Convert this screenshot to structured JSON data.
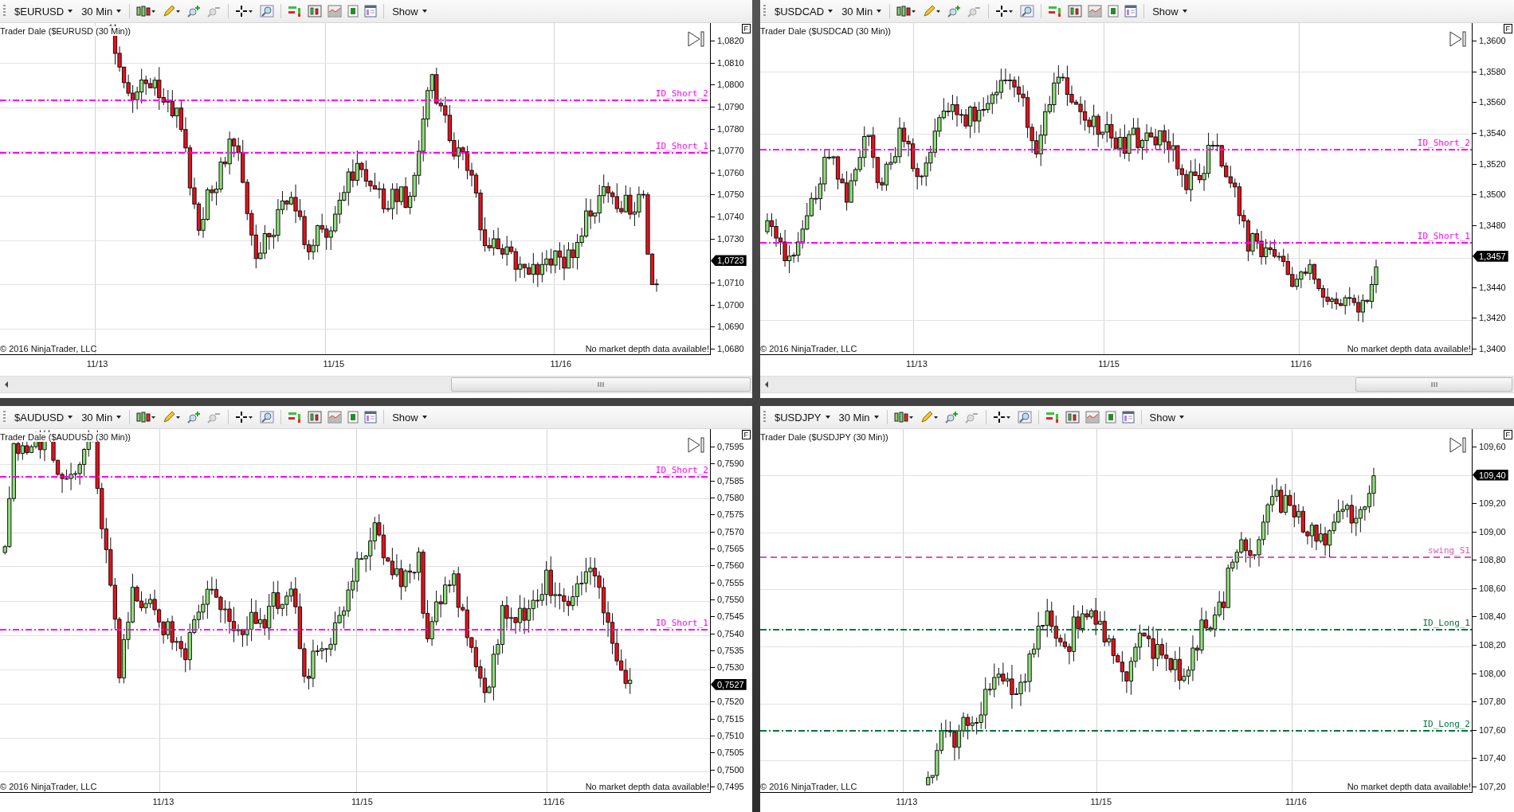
{
  "panels": [
    {
      "symbol": "$EURUSD",
      "interval": "30 Min",
      "show_menu": "Show",
      "title": "Trader Dale  ($EURUSD (30 Min))",
      "copyright": "© 2016 NinjaTrader, LLC",
      "notice": "No market depth data available!",
      "f_button": "F",
      "scroll_bar": true,
      "price_axis": [
        {
          "kind": "tick",
          "label": "1,0820"
        },
        {
          "kind": "tick",
          "label": "1,0810"
        },
        {
          "kind": "tick",
          "label": "1,0800"
        },
        {
          "kind": "tick",
          "label": "1,0790"
        },
        {
          "kind": "tick",
          "label": "1,0780"
        },
        {
          "kind": "tick",
          "label": "1,0770"
        },
        {
          "kind": "tick",
          "label": "1,0760"
        },
        {
          "kind": "tick",
          "label": "1,0750"
        },
        {
          "kind": "tick",
          "label": "1,0740"
        },
        {
          "kind": "tick",
          "label": "1,0730"
        },
        {
          "kind": "current",
          "label": "1,0723"
        },
        {
          "kind": "tick",
          "label": "1,0710"
        },
        {
          "kind": "tick",
          "label": "1,0700"
        },
        {
          "kind": "tick",
          "label": "1,0690"
        },
        {
          "kind": "tick",
          "label": "1,0680"
        }
      ],
      "levels": [
        {
          "label": "ID_Short_2",
          "kind": "dash_dot",
          "color": "#ff00ff"
        },
        {
          "label": "ID_Short_1",
          "kind": "dash_dot",
          "color": "#ff00ff"
        }
      ],
      "dates": [
        "11/13",
        "11/15",
        "11/16"
      ]
    },
    {
      "symbol": "$USDCAD",
      "interval": "30 Min",
      "show_menu": "Show",
      "title": "Trader Dale  ($USDCAD (30 Min))",
      "copyright": "© 2016 NinjaTrader, LLC",
      "notice": "No market depth data available!",
      "f_button": "F",
      "scroll_bar": true,
      "price_axis": [
        {
          "kind": "tick",
          "label": "1,3600"
        },
        {
          "kind": "tick",
          "label": "1,3580"
        },
        {
          "kind": "tick",
          "label": "1,3560"
        },
        {
          "kind": "tick",
          "label": "1,3540"
        },
        {
          "kind": "tick",
          "label": "1,3520"
        },
        {
          "kind": "tick",
          "label": "1,3500"
        },
        {
          "kind": "tick",
          "label": "1,3480"
        },
        {
          "kind": "current",
          "label": "1,3457"
        },
        {
          "kind": "tick",
          "label": "1,3440"
        },
        {
          "kind": "tick",
          "label": "1,3420"
        },
        {
          "kind": "tick",
          "label": "1,3400"
        }
      ],
      "levels": [
        {
          "label": "ID_Short_2",
          "kind": "dash_dot",
          "color": "#ff00ff"
        },
        {
          "label": "ID_Short_1",
          "kind": "dash_dot",
          "color": "#ff00ff"
        }
      ],
      "dates": [
        "11/13",
        "11/15",
        "11/16"
      ]
    },
    {
      "symbol": "$AUDUSD",
      "interval": "30 Min",
      "show_menu": "Show",
      "title": "Trader Dale  ($AUDUSD (30 Min))",
      "copyright": "© 2016 NinjaTrader, LLC",
      "notice": "No market depth data available!",
      "f_button": "F",
      "scroll_bar": false,
      "price_axis": [
        {
          "kind": "tick",
          "label": "0,7595"
        },
        {
          "kind": "tick",
          "label": "0,7590"
        },
        {
          "kind": "tick",
          "label": "0,7585"
        },
        {
          "kind": "tick",
          "label": "0,7580"
        },
        {
          "kind": "tick",
          "label": "0,7575"
        },
        {
          "kind": "tick",
          "label": "0,7570"
        },
        {
          "kind": "tick",
          "label": "0,7565"
        },
        {
          "kind": "tick",
          "label": "0,7560"
        },
        {
          "kind": "tick",
          "label": "0,7555"
        },
        {
          "kind": "tick",
          "label": "0,7550"
        },
        {
          "kind": "tick",
          "label": "0,7545"
        },
        {
          "kind": "tick",
          "label": "0,7540"
        },
        {
          "kind": "tick",
          "label": "0,7535"
        },
        {
          "kind": "tick",
          "label": "0,7530"
        },
        {
          "kind": "current",
          "label": "0,7527"
        },
        {
          "kind": "tick",
          "label": "0,7520"
        },
        {
          "kind": "tick",
          "label": "0,7515"
        },
        {
          "kind": "tick",
          "label": "0,7510"
        },
        {
          "kind": "tick",
          "label": "0,7505"
        },
        {
          "kind": "tick",
          "label": "0,7500"
        },
        {
          "kind": "tick",
          "label": "0,7495"
        }
      ],
      "levels": [
        {
          "label": "ID_Short_2",
          "kind": "dash_dot",
          "color": "#ff00ff"
        },
        {
          "label": "ID_Short_1",
          "kind": "dash_dot",
          "color": "#ff00ff"
        }
      ],
      "dates": [
        "11/13",
        "11/15",
        "11/16"
      ]
    },
    {
      "symbol": "$USDJPY",
      "interval": "30 Min",
      "show_menu": "Show",
      "title": "Trader Dale  ($USDJPY (30 Min))",
      "copyright": "© 2016 NinjaTrader, LLC",
      "notice": "No market depth data available!",
      "f_button": "F",
      "scroll_bar": false,
      "price_axis": [
        {
          "kind": "tick",
          "label": "109,60"
        },
        {
          "kind": "current",
          "label": "109,40"
        },
        {
          "kind": "tick",
          "label": "109,20"
        },
        {
          "kind": "tick",
          "label": "109,00"
        },
        {
          "kind": "tick",
          "label": "108,80"
        },
        {
          "kind": "tick",
          "label": "108,60"
        },
        {
          "kind": "tick",
          "label": "108,40"
        },
        {
          "kind": "tick",
          "label": "108,20"
        },
        {
          "kind": "tick",
          "label": "108,00"
        },
        {
          "kind": "tick",
          "label": "107,80"
        },
        {
          "kind": "tick",
          "label": "107,60"
        },
        {
          "kind": "tick",
          "label": "107,40"
        },
        {
          "kind": "tick",
          "label": "107,20"
        }
      ],
      "levels": [
        {
          "label": "swing_S1",
          "kind": "dashed",
          "color": "#d858b0"
        },
        {
          "label": "ID_Long_1",
          "kind": "dash_dot",
          "color": "#00753a"
        },
        {
          "label": "ID_Long_2",
          "kind": "dash_dot",
          "color": "#00753a"
        }
      ],
      "dates": [
        "11/13",
        "11/15",
        "11/16"
      ]
    }
  ]
}
